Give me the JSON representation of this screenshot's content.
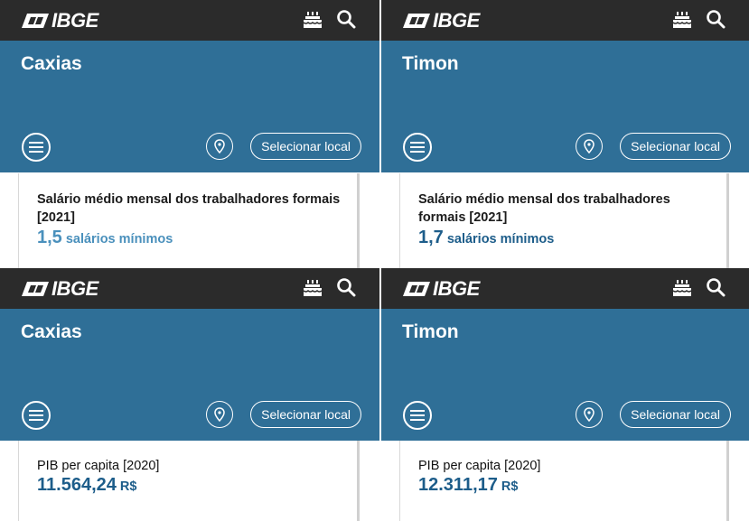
{
  "brand": {
    "logo_text": "IBGE",
    "accent": "#2f6f97",
    "topbar": "#2b2b2b"
  },
  "icons": {
    "cake": "cake-icon",
    "search": "search-icon",
    "menu": "hamburger-menu-icon",
    "pin": "location-pin-icon"
  },
  "panels": [
    {
      "city": "Caxias",
      "select_label": "Selecionar local",
      "metric_label": "Salário médio mensal dos trabalhadores formais [2021]",
      "metric_value": "1,5",
      "metric_unit": "salários mínimos"
    },
    {
      "city": "Timon",
      "select_label": "Selecionar local",
      "metric_label": "Salário médio mensal dos trabalhadores formais [2021]",
      "metric_value": "1,7",
      "metric_unit": "salários mínimos"
    },
    {
      "city": "Caxias",
      "select_label": "Selecionar local",
      "metric_label": "PIB per capita [2020]",
      "metric_value": "11.564,24",
      "metric_unit": "R$"
    },
    {
      "city": "Timon",
      "select_label": "Selecionar local",
      "metric_label": "PIB per capita [2020]",
      "metric_value": "12.311,17",
      "metric_unit": "R$"
    }
  ]
}
